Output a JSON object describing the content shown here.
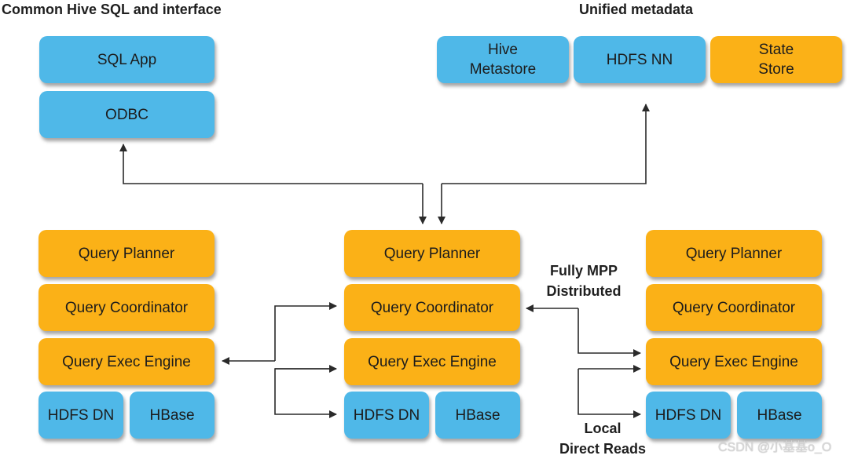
{
  "headings": {
    "left": "Common Hive SQL and interface",
    "right": "Unified metadata"
  },
  "client_stack": {
    "sql_app": "SQL App",
    "odbc": "ODBC"
  },
  "metadata": {
    "hive_metastore": "Hive\nMetastore",
    "hdfs_nn": "HDFS NN",
    "state_store": "State\nStore"
  },
  "nodes": [
    {
      "name": "left",
      "planner": "Query Planner",
      "coordinator": "Query Coordinator",
      "exec_engine": "Query Exec Engine",
      "hdfs_dn": "HDFS DN",
      "hbase": "HBase"
    },
    {
      "name": "center",
      "planner": "Query Planner",
      "coordinator": "Query Coordinator",
      "exec_engine": "Query Exec Engine",
      "hdfs_dn": "HDFS DN",
      "hbase": "HBase"
    },
    {
      "name": "right",
      "planner": "Query Planner",
      "coordinator": "Query Coordinator",
      "exec_engine": "Query Exec Engine",
      "hdfs_dn": "HDFS DN",
      "hbase": "HBase"
    }
  ],
  "annotations": {
    "fully_mpp": "Fully MPP\nDistributed",
    "local_reads": "Local\nDirect Reads"
  },
  "colors": {
    "blue": "#4fb8e8",
    "orange": "#fbb117",
    "arrow": "#2a2a2a"
  },
  "watermark": "CSDN @小基基o_O"
}
